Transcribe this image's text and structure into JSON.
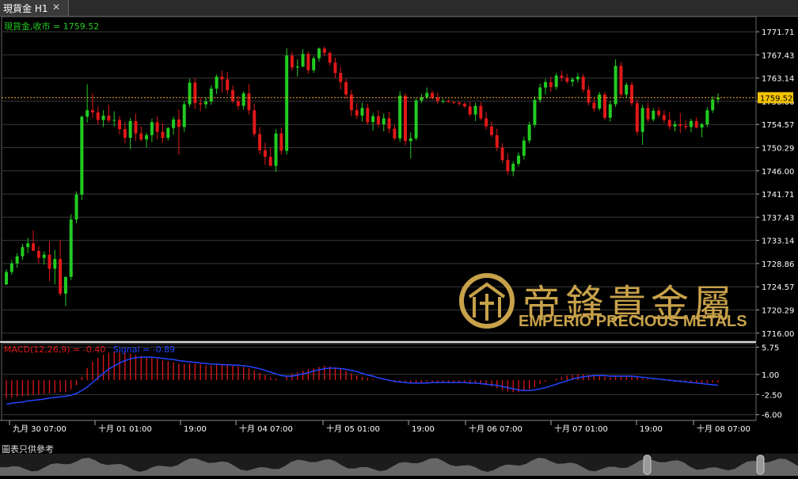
{
  "tab": {
    "title": "現貨金 H1",
    "close_glyph": "✕"
  },
  "price_legend": "現貨金,收市 = 1759.52",
  "macd_legend": {
    "label": "MACD(12,26,9) = -0.40",
    "signal": "Signal = -0.89"
  },
  "footer_note": "圖表只供參考",
  "watermark": {
    "chinese": "帝鋒貴金屬",
    "english": "EMPERIO PRECIOUS METALS"
  },
  "colors": {
    "up": "#22cc22",
    "down": "#e01818",
    "grid": "#3a3a3a",
    "axis_text": "#ffffff",
    "last_price": "#f5a623",
    "last_price_box": "#f5c400",
    "macd_hist": "#e01818",
    "signal": "#2244ff",
    "legend_green": "#22cc22",
    "legend_red": "#e01818",
    "watermark_gold": "#c8a24a"
  },
  "chart_data": [
    {
      "type": "candlestick",
      "title": "現貨金 H1",
      "ylim": [
        1714.5,
        1774.5
      ],
      "y_ticks": [
        "1771.71",
        "1767.43",
        "1763.14",
        "1758.86",
        "1754.57",
        "1750.29",
        "1746.00",
        "1741.71",
        "1737.43",
        "1733.14",
        "1728.86",
        "1724.57",
        "1720.29",
        "1716.00"
      ],
      "last_price": "1759.52",
      "x_labels": [
        "九月 30 07:00",
        "十月 01 01:00",
        "19:00",
        "十月 04 07:00",
        "十月 05 01:00",
        "19:00",
        "十月 06 07:00",
        "十月 07 01:00",
        "19:00",
        "十月 08 07:00"
      ],
      "ohlc": [
        [
          1725.0,
          1727.8,
          1724.9,
          1727.3
        ],
        [
          1727.3,
          1729.5,
          1726.8,
          1728.9
        ],
        [
          1728.9,
          1730.8,
          1728.1,
          1730.2
        ],
        [
          1730.2,
          1732.5,
          1729.5,
          1731.9
        ],
        [
          1731.9,
          1733.6,
          1730.8,
          1732.6
        ],
        [
          1732.6,
          1735.0,
          1731.4,
          1731.2
        ],
        [
          1731.2,
          1732.1,
          1728.9,
          1729.9
        ],
        [
          1729.9,
          1731.1,
          1728.7,
          1730.5
        ],
        [
          1730.5,
          1733.0,
          1725.6,
          1727.9
        ],
        [
          1727.9,
          1731.4,
          1725.0,
          1729.7
        ],
        [
          1729.7,
          1733.2,
          1722.9,
          1723.3
        ],
        [
          1723.3,
          1723.9,
          1721.0,
          1726.4
        ],
        [
          1726.4,
          1738.0,
          1725.8,
          1737.0
        ],
        [
          1737.0,
          1742.2,
          1736.3,
          1741.6
        ],
        [
          1741.6,
          1756.2,
          1740.6,
          1756.0
        ],
        [
          1756.0,
          1762.0,
          1754.9,
          1757.2
        ],
        [
          1757.2,
          1760.3,
          1755.8,
          1756.8
        ],
        [
          1756.8,
          1757.9,
          1754.6,
          1755.4
        ],
        [
          1755.4,
          1757.2,
          1754.1,
          1756.2
        ],
        [
          1756.2,
          1758.2,
          1754.9,
          1755.3
        ],
        [
          1755.3,
          1757.0,
          1754.2,
          1755.4
        ],
        [
          1755.4,
          1756.1,
          1752.7,
          1753.7
        ],
        [
          1753.7,
          1755.0,
          1751.1,
          1752.1
        ],
        [
          1752.1,
          1755.8,
          1750.0,
          1755.2
        ],
        [
          1755.2,
          1756.6,
          1751.5,
          1752.9
        ],
        [
          1752.9,
          1754.2,
          1751.4,
          1751.8
        ],
        [
          1751.8,
          1753.0,
          1750.3,
          1752.6
        ],
        [
          1752.6,
          1755.6,
          1751.3,
          1755.0
        ],
        [
          1755.0,
          1756.1,
          1751.8,
          1753.2
        ],
        [
          1753.2,
          1754.8,
          1751.2,
          1752.1
        ],
        [
          1752.1,
          1754.1,
          1751.6,
          1753.9
        ],
        [
          1753.9,
          1756.0,
          1752.7,
          1755.5
        ],
        [
          1755.5,
          1757.3,
          1748.9,
          1754.1
        ],
        [
          1754.1,
          1758.9,
          1753.2,
          1758.3
        ],
        [
          1758.3,
          1763.0,
          1757.8,
          1762.3
        ],
        [
          1762.3,
          1763.1,
          1757.4,
          1758.5
        ],
        [
          1758.5,
          1759.5,
          1757.0,
          1758.3
        ],
        [
          1758.3,
          1759.6,
          1757.5,
          1758.8
        ],
        [
          1758.8,
          1761.8,
          1758.2,
          1761.2
        ],
        [
          1761.2,
          1763.8,
          1760.2,
          1763.4
        ],
        [
          1763.4,
          1764.5,
          1760.4,
          1762.9
        ],
        [
          1762.9,
          1764.3,
          1760.2,
          1760.9
        ],
        [
          1760.9,
          1761.8,
          1758.5,
          1758.9
        ],
        [
          1758.9,
          1759.9,
          1757.3,
          1758.0
        ],
        [
          1758.0,
          1760.7,
          1757.3,
          1760.3
        ],
        [
          1760.3,
          1762.0,
          1756.4,
          1757.2
        ],
        [
          1757.2,
          1758.4,
          1752.3,
          1752.8
        ],
        [
          1752.8,
          1754.1,
          1749.1,
          1749.8
        ],
        [
          1749.8,
          1751.2,
          1747.1,
          1748.6
        ],
        [
          1748.6,
          1750.3,
          1747.2,
          1746.9
        ],
        [
          1746.9,
          1753.7,
          1745.8,
          1752.9
        ],
        [
          1752.9,
          1754.0,
          1749.0,
          1749.7
        ],
        [
          1749.7,
          1768.7,
          1749.0,
          1767.3
        ],
        [
          1767.3,
          1768.0,
          1764.5,
          1765.1
        ],
        [
          1765.1,
          1766.6,
          1763.4,
          1765.3
        ],
        [
          1765.3,
          1768.5,
          1765.1,
          1767.6
        ],
        [
          1767.6,
          1768.1,
          1763.9,
          1764.6
        ],
        [
          1764.6,
          1767.2,
          1764.1,
          1766.8
        ],
        [
          1766.8,
          1768.8,
          1766.2,
          1768.6
        ],
        [
          1768.6,
          1769.0,
          1767.2,
          1767.8
        ],
        [
          1767.8,
          1768.1,
          1765.4,
          1766.0
        ],
        [
          1766.0,
          1766.9,
          1763.2,
          1764.1
        ],
        [
          1764.1,
          1765.2,
          1761.0,
          1762.4
        ],
        [
          1762.4,
          1763.0,
          1759.3,
          1760.1
        ],
        [
          1760.1,
          1760.9,
          1756.1,
          1757.2
        ],
        [
          1757.2,
          1758.5,
          1755.6,
          1756.2
        ],
        [
          1756.2,
          1758.6,
          1755.1,
          1757.6
        ],
        [
          1757.6,
          1758.4,
          1754.5,
          1755.0
        ],
        [
          1755.0,
          1756.7,
          1753.4,
          1756.1
        ],
        [
          1756.1,
          1757.2,
          1754.0,
          1754.6
        ],
        [
          1754.6,
          1756.6,
          1753.3,
          1755.7
        ],
        [
          1755.7,
          1756.9,
          1753.0,
          1753.8
        ],
        [
          1753.8,
          1754.5,
          1751.6,
          1752.0
        ],
        [
          1752.0,
          1760.7,
          1751.3,
          1759.9
        ],
        [
          1759.9,
          1760.3,
          1750.7,
          1751.5
        ],
        [
          1751.5,
          1753.1,
          1748.3,
          1752.0
        ],
        [
          1752.0,
          1759.4,
          1751.6,
          1759.0
        ],
        [
          1759.0,
          1760.2,
          1758.5,
          1759.6
        ],
        [
          1759.6,
          1761.4,
          1759.2,
          1760.4
        ],
        [
          1760.4,
          1760.8,
          1759.1,
          1759.5
        ],
        [
          1759.5,
          1760.5,
          1758.4,
          1758.9
        ],
        [
          1758.9,
          1759.3,
          1758.5,
          1758.9
        ],
        [
          1758.9,
          1759.2,
          1758.6,
          1758.7
        ],
        [
          1758.7,
          1759.0,
          1758.3,
          1758.6
        ],
        [
          1758.6,
          1758.9,
          1758.0,
          1758.4
        ],
        [
          1758.4,
          1758.7,
          1757.6,
          1757.9
        ],
        [
          1757.9,
          1758.8,
          1756.0,
          1756.4
        ],
        [
          1756.4,
          1758.6,
          1755.2,
          1758.0
        ],
        [
          1758.0,
          1758.7,
          1755.3,
          1755.7
        ],
        [
          1755.7,
          1756.9,
          1753.6,
          1754.2
        ],
        [
          1754.2,
          1755.1,
          1752.2,
          1752.6
        ],
        [
          1752.6,
          1753.8,
          1749.7,
          1750.3
        ],
        [
          1750.3,
          1751.1,
          1747.4,
          1748.0
        ],
        [
          1748.0,
          1749.2,
          1745.2,
          1745.9
        ],
        [
          1745.9,
          1747.8,
          1745.0,
          1747.3
        ],
        [
          1747.3,
          1749.4,
          1746.8,
          1748.8
        ],
        [
          1748.8,
          1752.3,
          1748.1,
          1751.6
        ],
        [
          1751.6,
          1755.1,
          1751.1,
          1754.5
        ],
        [
          1754.5,
          1759.8,
          1754.0,
          1759.1
        ],
        [
          1759.1,
          1762.1,
          1758.6,
          1761.4
        ],
        [
          1761.4,
          1763.0,
          1760.1,
          1762.4
        ],
        [
          1762.4,
          1763.4,
          1760.6,
          1761.5
        ],
        [
          1761.5,
          1764.1,
          1761.0,
          1763.6
        ],
        [
          1763.6,
          1764.5,
          1762.5,
          1763.2
        ],
        [
          1763.2,
          1763.9,
          1762.1,
          1762.5
        ],
        [
          1762.5,
          1763.3,
          1761.6,
          1762.9
        ],
        [
          1762.9,
          1764.0,
          1762.3,
          1763.4
        ],
        [
          1763.4,
          1763.9,
          1760.5,
          1761.0
        ],
        [
          1761.0,
          1761.8,
          1758.1,
          1758.6
        ],
        [
          1758.6,
          1759.4,
          1756.9,
          1757.5
        ],
        [
          1757.5,
          1760.6,
          1757.1,
          1760.1
        ],
        [
          1760.1,
          1760.6,
          1755.3,
          1755.8
        ],
        [
          1755.8,
          1758.9,
          1755.1,
          1758.3
        ],
        [
          1758.3,
          1766.6,
          1757.8,
          1765.4
        ],
        [
          1765.4,
          1766.1,
          1759.6,
          1760.1
        ],
        [
          1760.1,
          1762.3,
          1759.5,
          1761.9
        ],
        [
          1761.9,
          1762.4,
          1758.0,
          1758.5
        ],
        [
          1758.5,
          1759.3,
          1752.6,
          1753.2
        ],
        [
          1753.2,
          1758.2,
          1750.8,
          1757.6
        ],
        [
          1757.6,
          1758.6,
          1754.9,
          1755.5
        ],
        [
          1755.5,
          1757.6,
          1755.1,
          1757.1
        ],
        [
          1757.1,
          1757.8,
          1755.8,
          1756.3
        ],
        [
          1756.3,
          1757.2,
          1754.8,
          1755.4
        ],
        [
          1755.4,
          1756.8,
          1753.6,
          1754.2
        ],
        [
          1754.2,
          1755.2,
          1753.3,
          1754.6
        ],
        [
          1754.6,
          1756.7,
          1753.0,
          1754.3
        ],
        [
          1754.3,
          1755.3,
          1753.6,
          1754.1
        ],
        [
          1754.1,
          1755.6,
          1753.1,
          1755.2
        ],
        [
          1755.2,
          1755.9,
          1753.8,
          1754.0
        ],
        [
          1754.0,
          1754.9,
          1752.2,
          1754.6
        ],
        [
          1754.6,
          1757.8,
          1754.1,
          1757.2
        ],
        [
          1757.2,
          1759.8,
          1756.7,
          1759.2
        ],
        [
          1759.2,
          1760.3,
          1758.5,
          1759.52
        ]
      ]
    },
    {
      "type": "bar",
      "title": "MACD(12,26,9) = -0.40",
      "series_name": "Signal = -0.89",
      "ylim": [
        -7.0,
        6.5
      ],
      "y_ticks": [
        "5.75",
        "1.00",
        "-2.50",
        "-6.00"
      ],
      "macd": [
        -3.1,
        -3.0,
        -2.9,
        -2.8,
        -2.7,
        -2.6,
        -2.5,
        -2.4,
        -2.3,
        -2.2,
        -2.1,
        -2.1,
        -1.6,
        -0.9,
        0.6,
        2.1,
        3.2,
        3.9,
        4.4,
        4.8,
        5.0,
        5.0,
        4.8,
        4.6,
        4.4,
        4.2,
        4.0,
        3.9,
        3.7,
        3.5,
        3.3,
        3.1,
        2.9,
        2.8,
        2.9,
        2.9,
        2.8,
        2.6,
        2.6,
        2.7,
        2.8,
        2.7,
        2.6,
        2.4,
        2.3,
        2.1,
        1.7,
        1.3,
        0.9,
        0.5,
        0.3,
        0.0,
        0.6,
        1.1,
        1.4,
        1.7,
        1.9,
        2.1,
        2.3,
        2.5,
        2.4,
        2.2,
        1.9,
        1.6,
        1.2,
        0.8,
        0.6,
        0.4,
        0.2,
        0.1,
        0.0,
        -0.2,
        -0.4,
        -0.3,
        -0.5,
        -0.6,
        -0.5,
        -0.4,
        -0.3,
        -0.3,
        -0.3,
        -0.3,
        -0.3,
        -0.3,
        -0.4,
        -0.5,
        -0.6,
        -0.6,
        -0.7,
        -0.9,
        -1.1,
        -1.4,
        -1.7,
        -2.0,
        -2.1,
        -2.1,
        -1.9,
        -1.6,
        -1.2,
        -0.7,
        -0.3,
        0.0,
        0.3,
        0.6,
        0.8,
        0.9,
        1.0,
        1.0,
        0.9,
        0.8,
        0.7,
        0.6,
        0.5,
        0.8,
        0.7,
        0.7,
        0.6,
        0.5,
        0.3,
        0.2,
        0.1,
        0.0,
        -0.1,
        -0.2,
        -0.3,
        -0.3,
        -0.4,
        -0.5,
        -0.5,
        -0.5,
        -0.5,
        -0.4,
        -0.4
      ],
      "signal": [
        -4.2,
        -4.0,
        -3.9,
        -3.8,
        -3.6,
        -3.5,
        -3.4,
        -3.3,
        -3.1,
        -3.0,
        -2.9,
        -2.8,
        -2.6,
        -2.3,
        -1.8,
        -1.2,
        -0.4,
        0.4,
        1.2,
        1.9,
        2.5,
        3.0,
        3.4,
        3.7,
        3.9,
        4.0,
        4.0,
        4.0,
        3.9,
        3.8,
        3.7,
        3.6,
        3.4,
        3.3,
        3.2,
        3.1,
        3.0,
        2.9,
        2.8,
        2.8,
        2.7,
        2.7,
        2.6,
        2.6,
        2.5,
        2.4,
        2.2,
        2.0,
        1.7,
        1.4,
        1.1,
        0.8,
        0.7,
        0.7,
        0.9,
        1.1,
        1.3,
        1.6,
        1.8,
        2.0,
        2.1,
        2.1,
        2.0,
        1.9,
        1.7,
        1.5,
        1.2,
        0.9,
        0.7,
        0.4,
        0.2,
        0.0,
        -0.2,
        -0.3,
        -0.4,
        -0.5,
        -0.5,
        -0.5,
        -0.5,
        -0.4,
        -0.4,
        -0.4,
        -0.4,
        -0.4,
        -0.4,
        -0.4,
        -0.5,
        -0.5,
        -0.6,
        -0.7,
        -0.8,
        -0.9,
        -1.1,
        -1.3,
        -1.5,
        -1.7,
        -1.8,
        -1.8,
        -1.7,
        -1.5,
        -1.3,
        -1.0,
        -0.7,
        -0.4,
        -0.1,
        0.2,
        0.4,
        0.6,
        0.7,
        0.8,
        0.8,
        0.8,
        0.7,
        0.7,
        0.7,
        0.7,
        0.7,
        0.6,
        0.5,
        0.4,
        0.3,
        0.2,
        0.1,
        0.0,
        -0.1,
        -0.2,
        -0.3,
        -0.4,
        -0.5,
        -0.6,
        -0.7,
        -0.8,
        -0.89
      ]
    }
  ]
}
